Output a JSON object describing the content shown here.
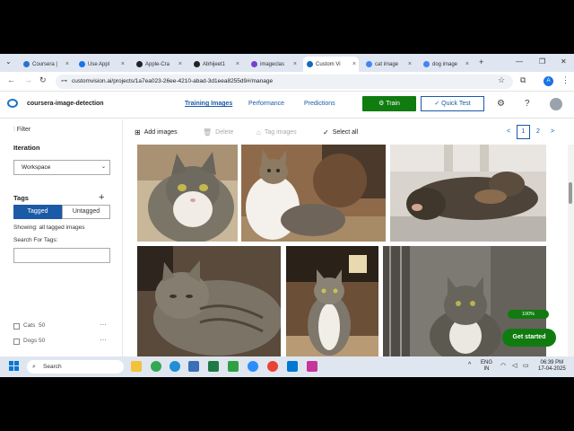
{
  "browser": {
    "tabs": [
      {
        "label": "Coursera |",
        "color": "#2a73cc"
      },
      {
        "label": "Use Appl",
        "color": "#1a73e8"
      },
      {
        "label": "Apple-Cra",
        "color": "#222222"
      },
      {
        "label": "Abhijeet1",
        "color": "#222222"
      },
      {
        "label": "imageclas",
        "color": "#7b3fd0"
      },
      {
        "label": "Custom Vi",
        "color": "#0f6cbd"
      },
      {
        "label": "cat image",
        "color": "#4285f4"
      },
      {
        "label": "dog image",
        "color": "#4285f4"
      }
    ],
    "new_tab": "+",
    "close_glyph": "×",
    "url": "customvision.ai/projects/1a7ea023-26ee-4210-abad-3d1eea8255d9#/manage"
  },
  "app": {
    "project_name": "coursera-image-detection",
    "nav": {
      "training_images": "Training Images",
      "performance": "Performance",
      "predictions": "Predictions"
    },
    "train_label": "Train",
    "quick_test_label": "Quick Test"
  },
  "sidebar": {
    "filter_label": "Filter",
    "iteration_heading": "Iteration",
    "iteration_value": "Workspace",
    "tags_heading": "Tags",
    "tagged_label": "Tagged",
    "untagged_label": "Untagged",
    "showing_text": "Showing: all tagged images",
    "search_tags_label": "Search For Tags:",
    "tags": [
      {
        "name": "Cats",
        "count": "50"
      },
      {
        "name": "Dogs",
        "count": "50"
      }
    ]
  },
  "toolbar": {
    "add_images": "Add images",
    "delete": "Delete",
    "tag_images": "Tag images",
    "select_all": "Select all",
    "pages": {
      "prev": "<",
      "current": "1",
      "next_page": "2",
      "next": ">"
    }
  },
  "overlay": {
    "progress": "100%",
    "get_started": "Get started"
  },
  "taskbar": {
    "search_label": "Search",
    "lang_line1": "ENG",
    "lang_line2": "IN",
    "time": "06:39 PM",
    "date": "17-04-2025"
  },
  "colors": {
    "accent": "#1a5aa6",
    "train_green": "#107c10"
  }
}
